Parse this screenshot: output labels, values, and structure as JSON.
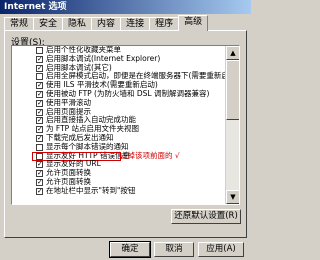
{
  "window": {
    "title": "Internet 选项"
  },
  "tabs": [
    {
      "label": "常规",
      "active": false
    },
    {
      "label": "安全",
      "active": false
    },
    {
      "label": "隐私",
      "active": false
    },
    {
      "label": "内容",
      "active": false
    },
    {
      "label": "连接",
      "active": false
    },
    {
      "label": "程序",
      "active": false
    },
    {
      "label": "高级",
      "active": true
    }
  ],
  "settings": {
    "label": "设置(S):",
    "items": [
      {
        "label": "启用个性化收藏夹菜单",
        "checked": false
      },
      {
        "label": "启用脚本调试(Internet Explorer)",
        "checked": true
      },
      {
        "label": "启用脚本调试(其它)",
        "checked": true
      },
      {
        "label": "启用全屏模式启动，即便是在终端服务器下(需要重新启动)",
        "checked": false
      },
      {
        "label": "使用 ILS 平滑技术(需要重新启动)",
        "checked": true
      },
      {
        "label": "使用被动 FTP (为防火墙和 DSL 调制解调器兼容)",
        "checked": true
      },
      {
        "label": "使用平滑滚动",
        "checked": true
      },
      {
        "label": "启用页面提示",
        "checked": true
      },
      {
        "label": "启用直接插入自动完成功能",
        "checked": true
      },
      {
        "label": "为 FTP 站点启用文件夹视图",
        "checked": true
      },
      {
        "label": "下载完成后发出通知",
        "checked": true
      },
      {
        "label": "显示每个脚本错误的通知",
        "checked": false
      },
      {
        "label": "显示友好 HTTP 错误信息",
        "checked": false,
        "highlighted": true,
        "annotation": "去掉该项前面的 √"
      },
      {
        "label": "显示友好的 URL",
        "checked": true
      },
      {
        "label": "允许页面转换",
        "checked": true
      },
      {
        "label": "允许页面转换",
        "checked": true
      },
      {
        "label": "在地址栏中显示\"转到\"按钮",
        "checked": true
      }
    ]
  },
  "restore_defaults_label": "还原默认设置(R)",
  "footer": {
    "ok_label": "确定",
    "cancel_label": "取消",
    "apply_label": "应用(A)"
  }
}
